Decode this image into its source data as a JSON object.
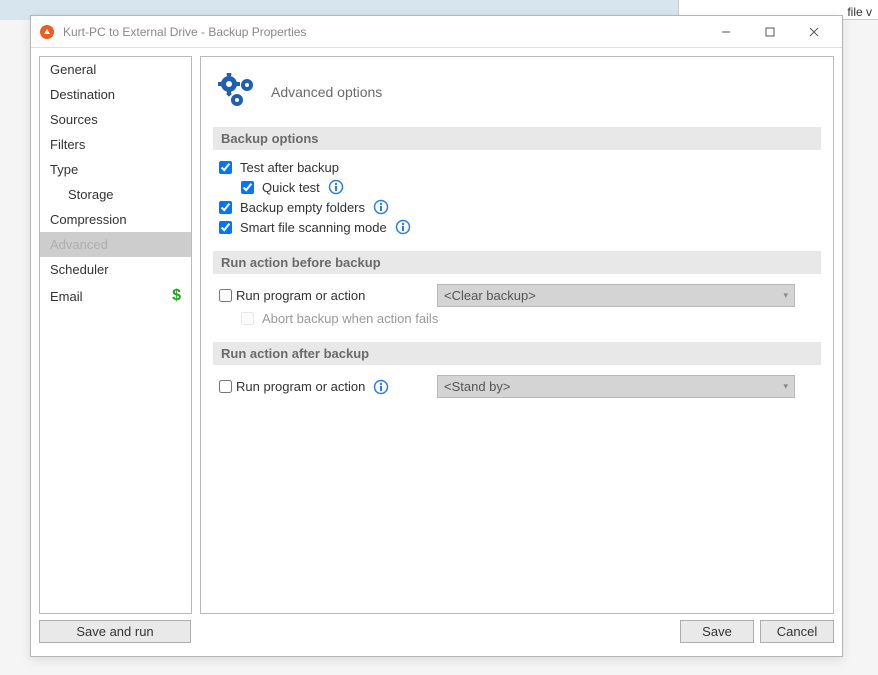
{
  "bg": {
    "snippet_text": "file v"
  },
  "window": {
    "title": "Kurt-PC to External Drive - Backup Properties"
  },
  "sidebar": {
    "items": [
      {
        "label": "General"
      },
      {
        "label": "Destination"
      },
      {
        "label": "Sources"
      },
      {
        "label": "Filters"
      },
      {
        "label": "Type"
      },
      {
        "label": "Storage",
        "indent": true
      },
      {
        "label": "Compression"
      },
      {
        "label": "Advanced",
        "selected": true
      },
      {
        "label": "Scheduler"
      },
      {
        "label": "Email",
        "has_dollar": true
      }
    ]
  },
  "content": {
    "header_title": "Advanced options",
    "sections": {
      "backup_options": {
        "label": "Backup options",
        "test_after_backup": "Test after backup",
        "quick_test": "Quick test",
        "backup_empty_folders": "Backup empty folders",
        "smart_file_scanning": "Smart file scanning mode"
      },
      "before": {
        "label": "Run action before backup",
        "run_program": "Run program or action",
        "abort_on_fail": "Abort backup when action fails",
        "select_value": "<Clear backup>"
      },
      "after": {
        "label": "Run action after backup",
        "run_program": "Run program or action",
        "select_value": "<Stand by>"
      }
    }
  },
  "footer": {
    "save_and_run": "Save and run",
    "save": "Save",
    "cancel": "Cancel"
  }
}
